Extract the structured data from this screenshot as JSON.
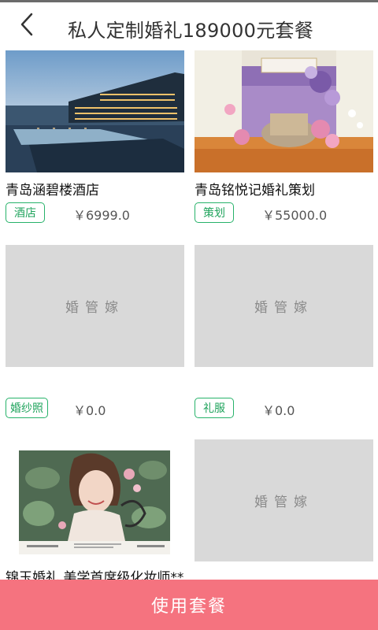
{
  "header": {
    "title": "私人定制婚礼189000元套餐",
    "back_icon": "chevron-left-icon"
  },
  "items": [
    {
      "name": "青岛涵碧楼酒店",
      "tag": "酒店",
      "price": "￥6999.0",
      "image": "hotel-photo"
    },
    {
      "name": "青岛铭悦记婚礼策划",
      "tag": "策划",
      "price": "￥55000.0",
      "image": "wedding-decor-photo"
    },
    {
      "name": "",
      "tag": "婚纱照",
      "price": "￥0.0",
      "placeholder": "婚管嫁"
    },
    {
      "name": "",
      "tag": "礼服",
      "price": "￥0.0",
      "placeholder": "婚管嫁"
    },
    {
      "name": "锦玉婚礼 美学首席级化妆师**",
      "image": "bride-portrait-photo"
    },
    {
      "name": "",
      "placeholder": "婚管嫁"
    }
  ],
  "bottom": {
    "button_label": "使用套餐"
  },
  "colors": {
    "accent": "#f5737f",
    "tag_green": "#27b26a",
    "placeholder_gray": "#d9d9d9"
  }
}
